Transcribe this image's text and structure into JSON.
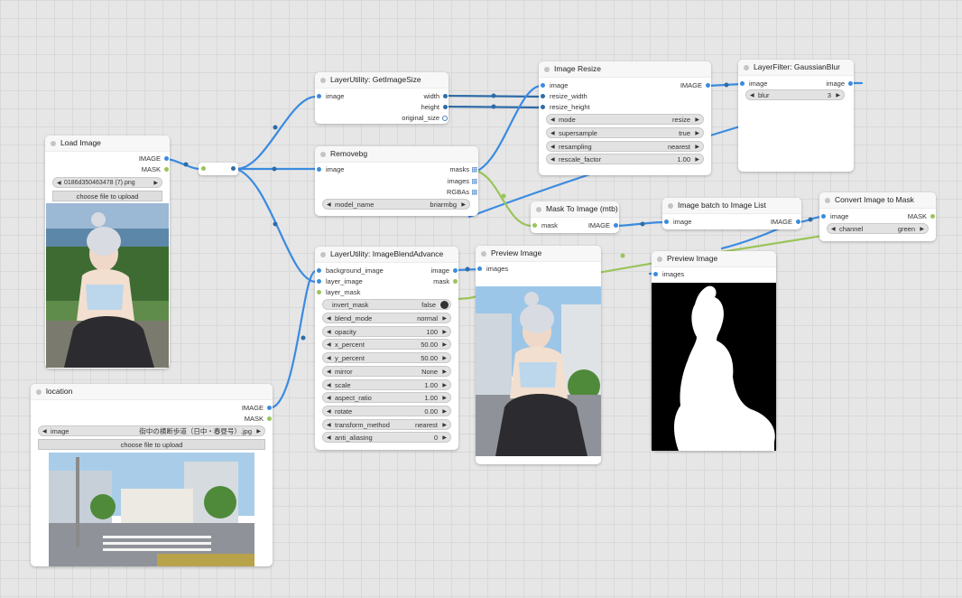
{
  "sockets": {
    "image": "image",
    "images": "images",
    "mask": "mask",
    "masks": "masks",
    "IMAGE": "IMAGE",
    "MASK": "MASK",
    "width": "width",
    "height": "height",
    "original_size": "original_size",
    "resize_width": "resize_width",
    "resize_height": "resize_height",
    "RGBAs": "RGBAs",
    "background_image": "background_image",
    "layer_image": "layer_image",
    "layer_mask": "layer_mask"
  },
  "load_image": {
    "title": "Load Image",
    "file": "0186d350463478 (7).png",
    "upload": "choose file to upload"
  },
  "location": {
    "title": "location",
    "image_label": "image",
    "file": "街中の横断歩道（日中・春昼号）.jpg",
    "upload": "choose file to upload"
  },
  "get_image_size": {
    "title": "LayerUtility: GetImageSize"
  },
  "removebg": {
    "title": "Removebg",
    "model_label": "model_name",
    "model_value": "briarmbg"
  },
  "image_resize": {
    "title": "Image Resize",
    "widgets": [
      {
        "label": "mode",
        "value": "resize"
      },
      {
        "label": "supersample",
        "value": "true"
      },
      {
        "label": "resampling",
        "value": "nearest"
      },
      {
        "label": "rescale_factor",
        "value": "1.00"
      }
    ]
  },
  "gaussian_blur": {
    "title": "LayerFilter: GaussianBlur",
    "blur_label": "blur",
    "blur_value": "3"
  },
  "mask_to_image": {
    "title": "Mask To Image (mtb)"
  },
  "batch_to_list": {
    "title": "Image batch to Image List"
  },
  "convert_to_mask": {
    "title": "Convert Image to Mask",
    "channel_label": "channel",
    "channel_value": "green"
  },
  "blend_advance": {
    "title": "LayerUtility: ImageBlendAdvance",
    "invert_label": "invert_mask",
    "invert_value": "false",
    "widgets": [
      {
        "label": "blend_mode",
        "value": "normal"
      },
      {
        "label": "opacity",
        "value": "100"
      },
      {
        "label": "x_percent",
        "value": "50.00"
      },
      {
        "label": "y_percent",
        "value": "50.00"
      },
      {
        "label": "mirror",
        "value": "None"
      },
      {
        "label": "scale",
        "value": "1.00"
      },
      {
        "label": "aspect_ratio",
        "value": "1.00"
      },
      {
        "label": "rotate",
        "value": "0.00"
      },
      {
        "label": "transform_method",
        "value": "nearest"
      },
      {
        "label": "anti_aliasing",
        "value": "0"
      }
    ]
  },
  "preview_1": {
    "title": "Preview Image"
  },
  "preview_2": {
    "title": "Preview Image"
  },
  "colors": {
    "link_blue": "#3b8be0",
    "link_green": "#9ac45a",
    "link_dark": "#2f6ba8"
  }
}
